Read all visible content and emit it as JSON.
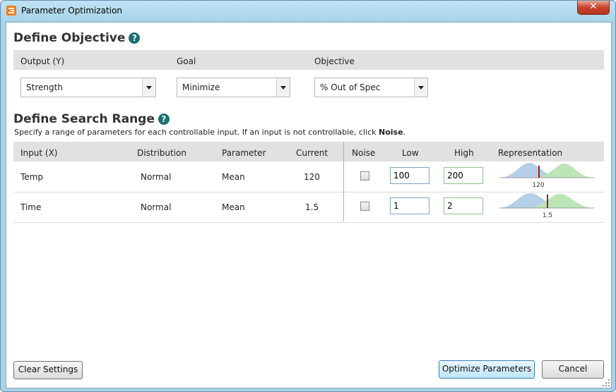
{
  "window": {
    "title": "Parameter Optimization",
    "close_label": "✕"
  },
  "objective": {
    "title": "Define Objective",
    "help": "?",
    "headers": {
      "output": "Output (Y)",
      "goal": "Goal",
      "objective": "Objective"
    },
    "output_value": "Strength",
    "goal_value": "Minimize",
    "objective_value": "% Out of Spec"
  },
  "search": {
    "title": "Define Search Range",
    "help": "?",
    "description_prefix": "Specify a range of parameters for each controllable input. If an input is not controllable, click ",
    "description_bold": "Noise",
    "description_suffix": ".",
    "headers": {
      "input": "Input (X)",
      "distribution": "Distribution",
      "parameter": "Parameter",
      "current": "Current",
      "noise": "Noise",
      "low": "Low",
      "high": "High",
      "representation": "Representation"
    },
    "rows": [
      {
        "input": "Temp",
        "distribution": "Normal",
        "parameter": "Mean",
        "current": "120",
        "noise": false,
        "low": "100",
        "high": "200",
        "rep_label": "120",
        "rep_marker": 0.42
      },
      {
        "input": "Time",
        "distribution": "Normal",
        "parameter": "Mean",
        "current": "1.5",
        "noise": false,
        "low": "1",
        "high": "2",
        "rep_label": "1.5",
        "rep_marker": 0.5
      }
    ]
  },
  "buttons": {
    "clear": "Clear Settings",
    "optimize": "Optimize Parameters",
    "cancel": "Cancel"
  },
  "colors": {
    "low_curve": "#b4cfe8",
    "high_curve": "#bde5b8",
    "marker": "#b0102a",
    "help": "#1a6f73"
  }
}
